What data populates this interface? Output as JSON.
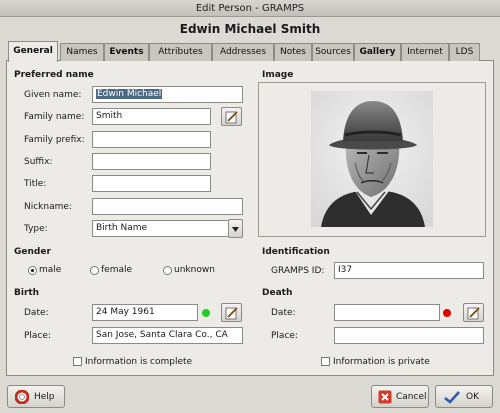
{
  "window": {
    "title": "Edit Person - GRAMPS"
  },
  "person_heading": "Edwin Michael Smith",
  "tabs": [
    {
      "label": "General"
    },
    {
      "label": "Names"
    },
    {
      "label": "Events"
    },
    {
      "label": "Attributes"
    },
    {
      "label": "Addresses"
    },
    {
      "label": "Notes"
    },
    {
      "label": "Sources"
    },
    {
      "label": "Gallery"
    },
    {
      "label": "Internet"
    },
    {
      "label": "LDS"
    }
  ],
  "preferred_name": {
    "heading": "Preferred name",
    "given_label": "Given name:",
    "given_value": "Edwin Michael",
    "family_label": "Family name:",
    "family_value": "Smith",
    "prefix_label": "Family prefix:",
    "prefix_value": "",
    "suffix_label": "Suffix:",
    "suffix_value": "",
    "title_label": "Title:",
    "title_value": "",
    "nickname_label": "Nickname:",
    "nickname_value": "",
    "type_label": "Type:",
    "type_value": "Birth Name"
  },
  "image": {
    "heading": "Image"
  },
  "gender": {
    "heading": "Gender",
    "options": [
      "male",
      "female",
      "unknown"
    ],
    "selected": "male"
  },
  "identification": {
    "heading": "Identification",
    "id_label": "GRAMPS ID:",
    "id_value": "I37"
  },
  "birth": {
    "heading": "Birth",
    "date_label": "Date:",
    "date_value": "24 May 1961",
    "status_color": "#22cc22",
    "place_label": "Place:",
    "place_value": "San Jose, Santa Clara Co., CA"
  },
  "death": {
    "heading": "Death",
    "date_label": "Date:",
    "date_value": "",
    "status_color": "#dd0000",
    "place_label": "Place:",
    "place_value": ""
  },
  "complete_label": "Information is complete",
  "private_label": "Information is private",
  "buttons": {
    "help": "Help",
    "cancel": "Cancel",
    "ok": "OK"
  }
}
